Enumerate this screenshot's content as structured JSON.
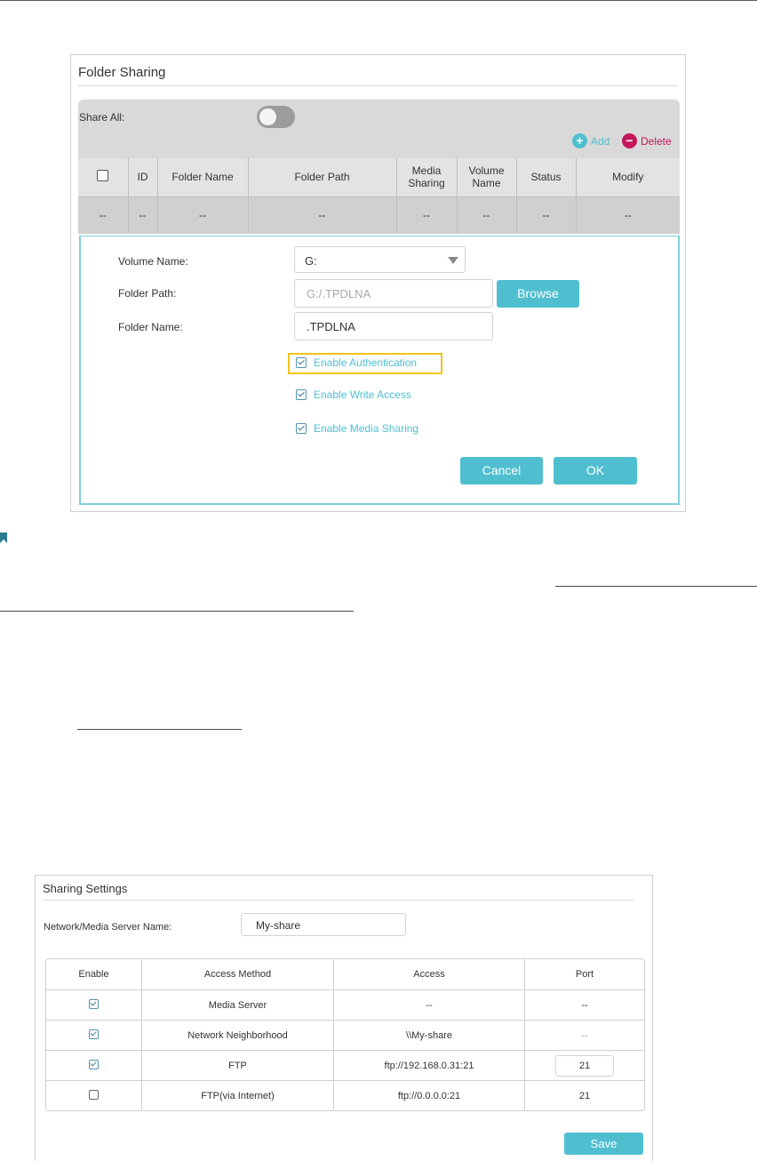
{
  "folder_sharing": {
    "title": "Folder Sharing",
    "share_all_label": "Share All:",
    "share_all_enabled": false,
    "add_label": "Add",
    "delete_label": "Delete",
    "columns": [
      "ID",
      "Folder Name",
      "Folder Path",
      "Media Sharing",
      "Volume Name",
      "Status",
      "Modify"
    ],
    "row": [
      "--",
      "--",
      "--",
      "--",
      "--",
      "--",
      "--",
      "--"
    ],
    "form": {
      "volume_name_label": "Volume Name:",
      "volume_name_value": "G:",
      "folder_path_label": "Folder Path:",
      "folder_path_value": "G:/.TPDLNA",
      "browse_label": "Browse",
      "folder_name_label": "Folder Name:",
      "folder_name_value": ".TPDLNA",
      "enable_authentication": "Enable Authentication",
      "enable_write_access": "Enable Write Access",
      "enable_media_sharing": "Enable Media Sharing",
      "cancel_label": "Cancel",
      "ok_label": "OK"
    }
  },
  "sharing_settings": {
    "title": "Sharing Settings",
    "server_name_label": "Network/Media Server Name:",
    "server_name_value": "My-share",
    "columns": [
      "Enable",
      "Access Method",
      "Access",
      "Port"
    ],
    "rows": [
      {
        "enabled": true,
        "method": "Media Server",
        "access": "--",
        "port": "--"
      },
      {
        "enabled": true,
        "method": "Network Neighborhood",
        "access": "\\\\My-share",
        "port": "--"
      },
      {
        "enabled": true,
        "method": "FTP",
        "access": "ftp://192.168.0.31:21",
        "port": "21"
      },
      {
        "enabled": false,
        "method": "FTP(via Internet)",
        "access": "ftp://0.0.0.0:21",
        "port": "21"
      }
    ],
    "save_label": "Save"
  },
  "colors": {
    "accent": "#4fbfd0",
    "delete": "#c2185b",
    "highlight": "#f5c518"
  }
}
